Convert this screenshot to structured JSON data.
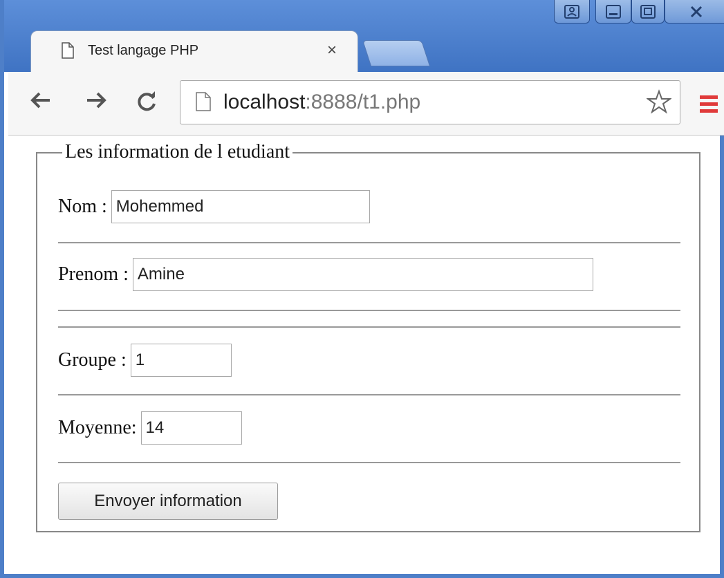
{
  "tab": {
    "title": "Test langage PHP",
    "close": "×"
  },
  "address": {
    "host": "localhost",
    "rest": ":8888/t1.php"
  },
  "icons": {
    "back": "back-arrow-icon",
    "forward": "forward-arrow-icon",
    "reload": "reload-icon",
    "page": "page-icon",
    "star": "bookmark-star-icon",
    "menu": "hamburger-menu-icon"
  },
  "colors": {
    "titlebar": "#4e7fc8",
    "menu": "#e03a3a"
  },
  "form": {
    "legend": "Les information de l etudiant",
    "nom_label": "Nom :",
    "nom_value": "Mohemmed",
    "prenom_label": "Prenom :",
    "prenom_value": "Amine",
    "groupe_label": "Groupe :",
    "groupe_value": "1",
    "moyenne_label": "Moyenne:",
    "moyenne_value": "14",
    "submit_label": "Envoyer information"
  }
}
